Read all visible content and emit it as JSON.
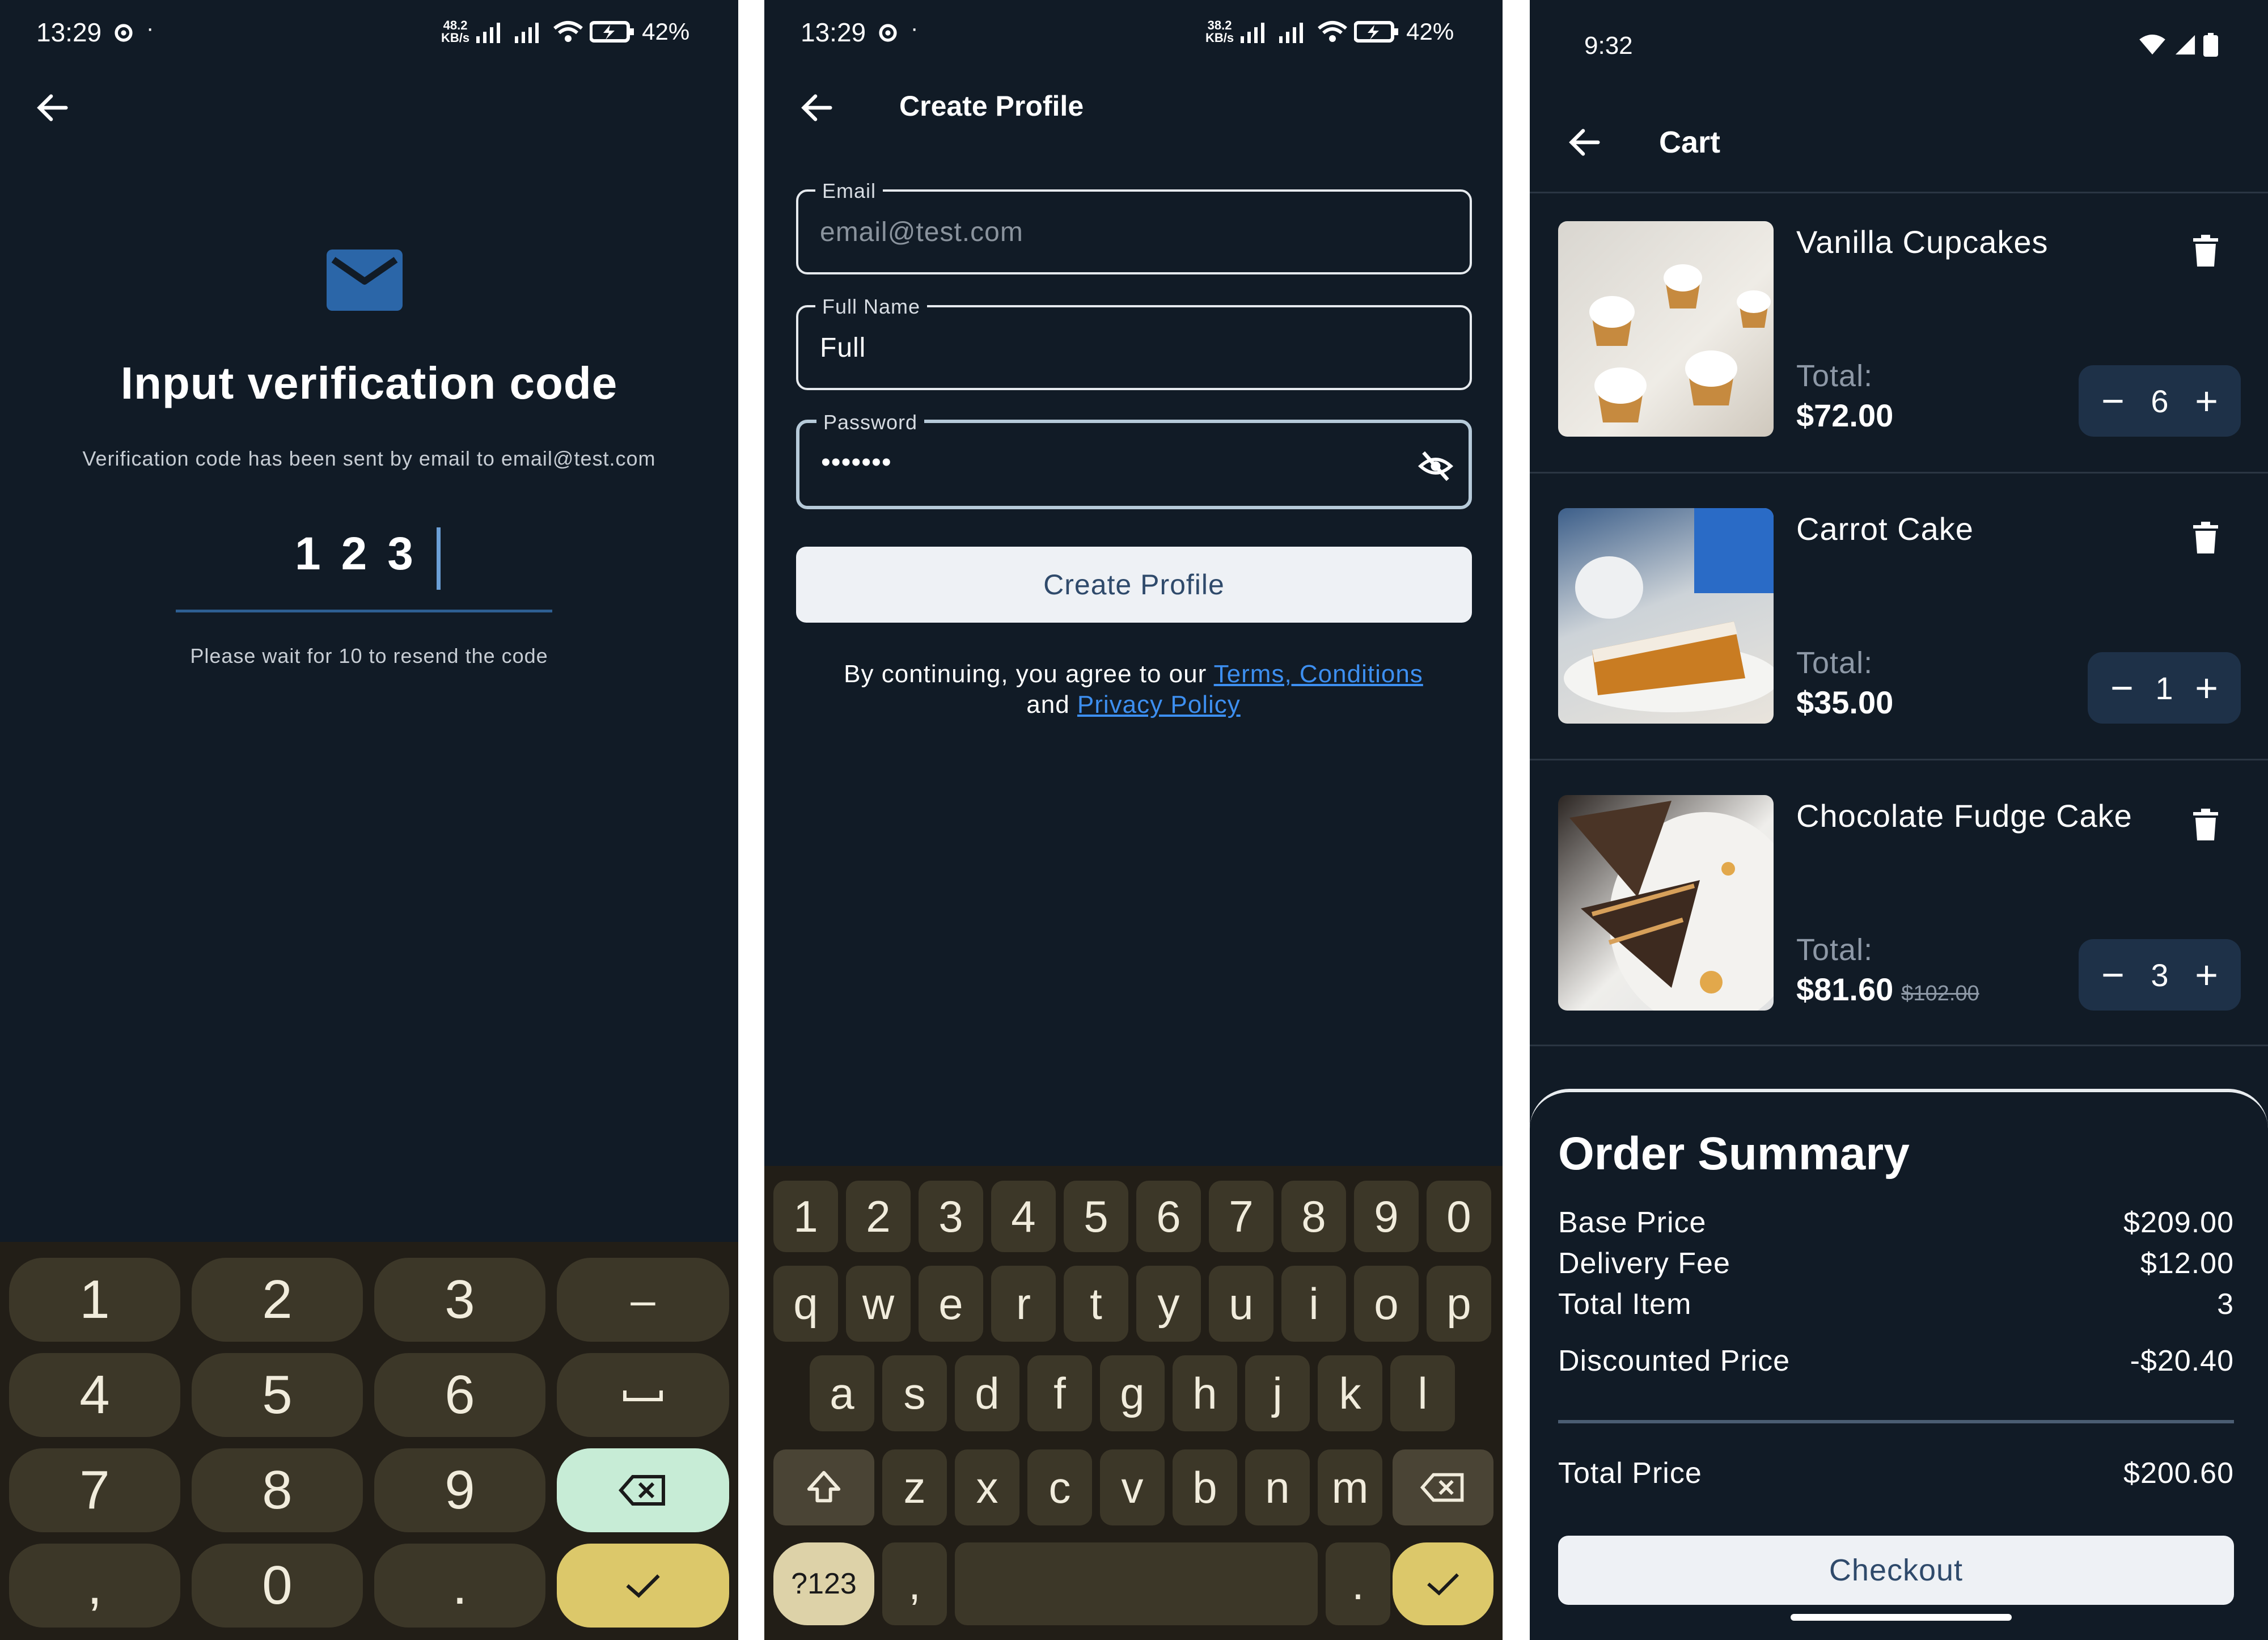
{
  "colors": {
    "background": "#111b26",
    "keyboard": "#221e17",
    "key": "#3c3728",
    "key_mint": "#c7ecd6",
    "key_gold": "#dcc86a",
    "accent_blue": "#2b66a8",
    "link": "#3d8ff0",
    "stepper_bg": "#1e3148"
  },
  "verification": {
    "status": {
      "time": "13:29",
      "net_speed": "48.2",
      "net_unit": "KB/s",
      "battery": "42%"
    },
    "back_icon": "arrow-left-icon",
    "mail_icon": "envelope-icon",
    "title": "Input verification code",
    "subtitle": "Verification code has been sent by email to email@test.com",
    "digits": [
      "1",
      "2",
      "3"
    ],
    "resend_text": "Please wait for 10 to resend the code",
    "keypad": {
      "rows": [
        [
          "1",
          "2",
          "3",
          "–"
        ],
        [
          "4",
          "5",
          "6",
          "␣"
        ],
        [
          "7",
          "8",
          "9",
          "⌫"
        ],
        [
          ",",
          "0",
          ".",
          "✓"
        ]
      ]
    }
  },
  "create_profile": {
    "status": {
      "time": "13:29",
      "net_speed": "38.2",
      "net_unit": "KB/s",
      "battery": "42%"
    },
    "title": "Create Profile",
    "email": {
      "label": "Email",
      "placeholder": "email@test.com"
    },
    "full_name": {
      "label": "Full Name",
      "value": "Full"
    },
    "password": {
      "label": "Password",
      "value": "•••••••",
      "toggle_icon": "eye-off-icon"
    },
    "button_label": "Create Profile",
    "legal": {
      "prefix": "By continuing, you agree to our",
      "terms_link": "Terms, Conditions",
      "and": "and",
      "privacy_link": "Privacy Policy"
    },
    "keyboard": {
      "row1": [
        "1",
        "2",
        "3",
        "4",
        "5",
        "6",
        "7",
        "8",
        "9",
        "0"
      ],
      "row2": [
        "q",
        "w",
        "e",
        "r",
        "t",
        "y",
        "u",
        "i",
        "o",
        "p"
      ],
      "row3": [
        "a",
        "s",
        "d",
        "f",
        "g",
        "h",
        "j",
        "k",
        "l"
      ],
      "row4": [
        "z",
        "x",
        "c",
        "v",
        "b",
        "n",
        "m"
      ],
      "symbols": "?123",
      "comma": ",",
      "period": "."
    }
  },
  "cart": {
    "status": {
      "time": "9:32"
    },
    "title": "Cart",
    "total_label": "Total:",
    "items": [
      {
        "name": "Vanilla Cupcakes",
        "total": "$72.00",
        "original": "",
        "qty": "6"
      },
      {
        "name": "Carrot Cake",
        "total": "$35.00",
        "original": "",
        "qty": "1"
      },
      {
        "name": "Chocolate Fudge Cake",
        "total": "$81.60",
        "original": "$102.00",
        "qty": "3"
      }
    ],
    "summary": {
      "title": "Order Summary",
      "rows": [
        {
          "label": "Base Price",
          "value": "$209.00"
        },
        {
          "label": "Delivery Fee",
          "value": "$12.00"
        },
        {
          "label": "Total Item",
          "value": "3"
        },
        {
          "label": "Discounted Price",
          "value": "-$20.40"
        }
      ],
      "total_label": "Total Price",
      "total_value": "$200.60",
      "checkout_label": "Checkout"
    }
  }
}
